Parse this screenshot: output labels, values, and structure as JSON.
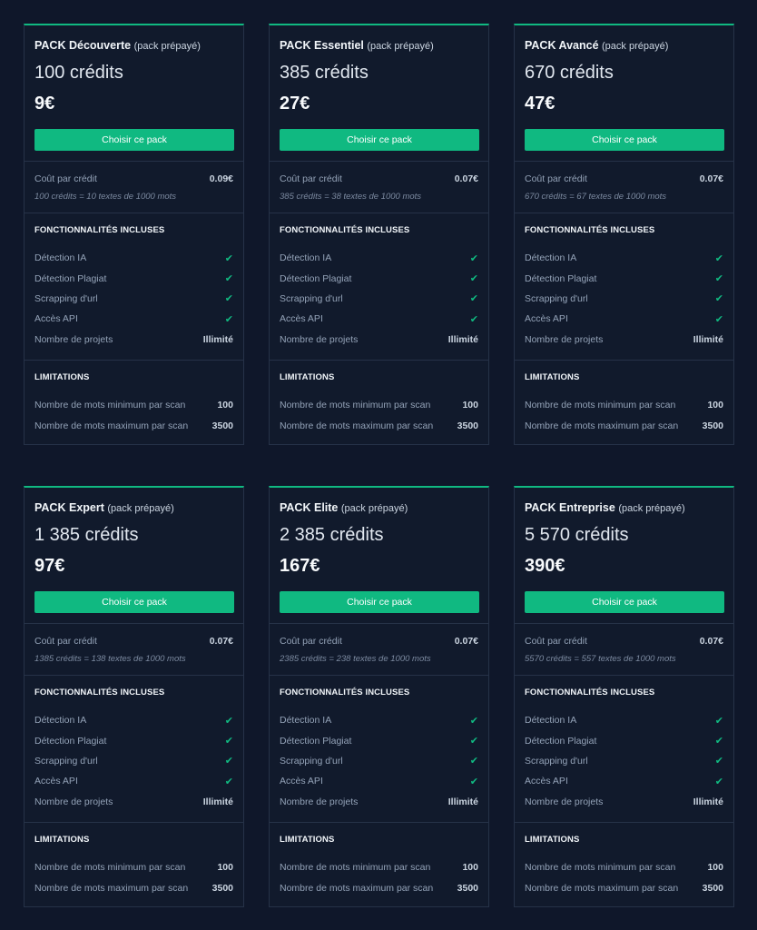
{
  "common": {
    "pack_prefix": "PACK",
    "pack_suffix": "(pack prépayé)",
    "button_label": "Choisir ce pack",
    "cost_label": "Coût par crédit",
    "features_title": "FONCTIONNALITÉS INCLUSES",
    "features": [
      {
        "label": "Détection IA",
        "value": "check"
      },
      {
        "label": "Détection Plagiat",
        "value": "check"
      },
      {
        "label": "Scrapping d'url",
        "value": "check"
      },
      {
        "label": "Accès API",
        "value": "check"
      },
      {
        "label": "Nombre de projets",
        "value": "Illimité"
      }
    ],
    "limits_title": "LIMITATIONS",
    "limits": [
      {
        "label": "Nombre de mots minimum par scan",
        "value": "100"
      },
      {
        "label": "Nombre de mots maximum par scan",
        "value": "3500"
      }
    ],
    "check_glyph": "✔",
    "accent_color": "#10b981"
  },
  "packs": [
    {
      "name": "Découverte",
      "credits": "100 crédits",
      "price": "9€",
      "cost": "0.09€",
      "note": "100 crédits = 10 textes de 1000 mots"
    },
    {
      "name": "Essentiel",
      "credits": "385 crédits",
      "price": "27€",
      "cost": "0.07€",
      "note": "385 crédits = 38 textes de 1000 mots"
    },
    {
      "name": "Avancé",
      "credits": "670 crédits",
      "price": "47€",
      "cost": "0.07€",
      "note": "670 crédits = 67 textes de 1000 mots"
    },
    {
      "name": "Expert",
      "credits": "1 385 crédits",
      "price": "97€",
      "cost": "0.07€",
      "note": "1385 crédits = 138 textes de 1000 mots"
    },
    {
      "name": "Elite",
      "credits": "2 385 crédits",
      "price": "167€",
      "cost": "0.07€",
      "note": "2385 crédits = 238 textes de 1000 mots"
    },
    {
      "name": "Entreprise",
      "credits": "5 570 crédits",
      "price": "390€",
      "cost": "0.07€",
      "note": "5570 crédits = 557 textes de 1000 mots"
    }
  ]
}
